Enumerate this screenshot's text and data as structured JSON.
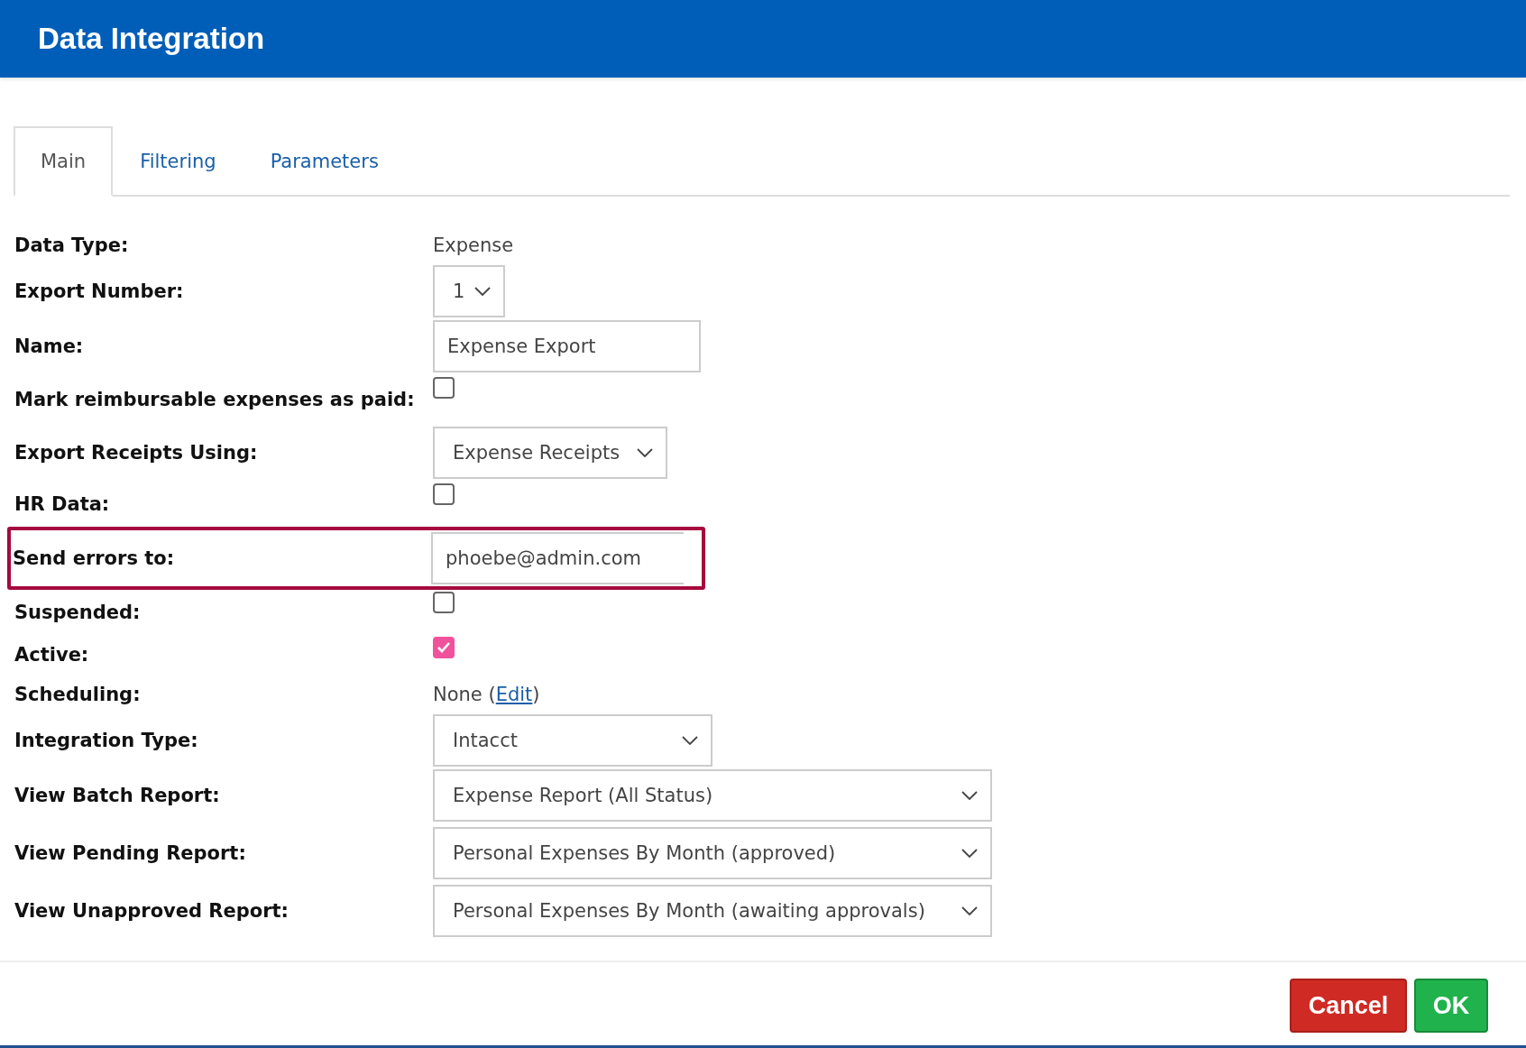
{
  "window": {
    "title": "Data Integration"
  },
  "tabs": [
    {
      "label": "Main",
      "selected": true
    },
    {
      "label": "Filtering",
      "selected": false
    },
    {
      "label": "Parameters",
      "selected": false
    }
  ],
  "fields": [
    {
      "kind": "text",
      "label": "Data Type:",
      "value": "Expense"
    },
    {
      "kind": "select",
      "label": "Export Number:",
      "value": "1"
    },
    {
      "kind": "input",
      "label": "Name:",
      "value": "Expense Export"
    },
    {
      "kind": "checkbox",
      "label": "Mark reimbursable expenses as paid:",
      "checked": false
    },
    {
      "kind": "select",
      "label": "Export Receipts Using:",
      "value": "Expense Receipts"
    },
    {
      "kind": "checkbox",
      "label": "HR Data:",
      "checked": false
    },
    {
      "kind": "input",
      "label": "Send errors to:",
      "value": "phoebe@admin.com",
      "highlighted": true
    },
    {
      "kind": "checkbox",
      "label": "Suspended:",
      "checked": false
    },
    {
      "kind": "checkbox",
      "label": "Active:",
      "checked": true
    },
    {
      "kind": "schedule",
      "label": "Scheduling:",
      "value": "None",
      "open": "(",
      "link": "Edit",
      "close": ")"
    },
    {
      "kind": "select",
      "label": "Integration Type:",
      "value": "Intacct"
    },
    {
      "kind": "select",
      "label": "View Batch Report:",
      "value": "Expense Report (All Status)"
    },
    {
      "kind": "select",
      "label": "View Pending Report:",
      "value": "Personal Expenses By Month (approved)"
    },
    {
      "kind": "select",
      "label": "View Unapproved Report:",
      "value": "Personal Expenses By Month (awaiting approvals)"
    }
  ],
  "buttons": [
    {
      "kind": "cancel",
      "label": "Cancel"
    },
    {
      "kind": "ok",
      "label": "OK"
    }
  ]
}
